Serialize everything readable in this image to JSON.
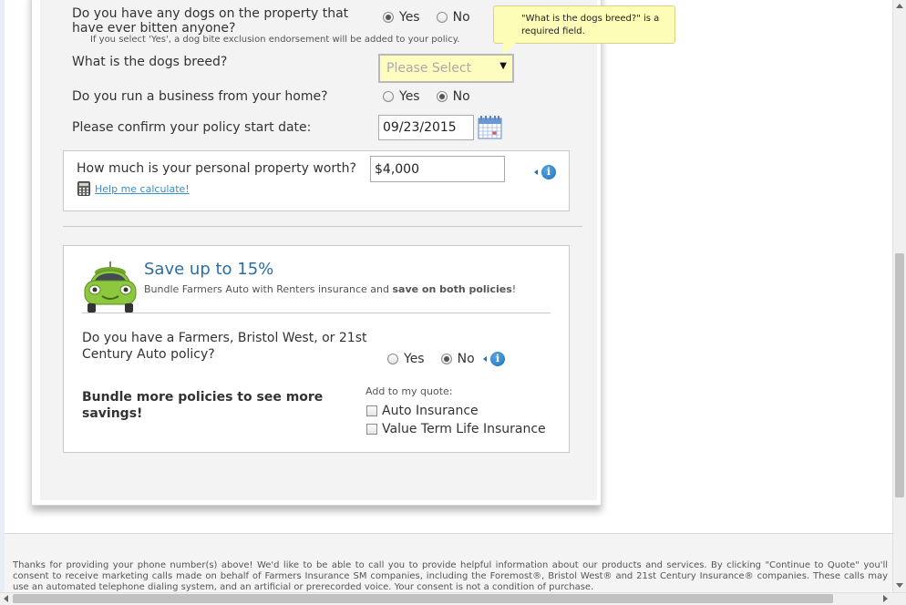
{
  "dogs_bitten": {
    "question": "Do you have any dogs on the property that have ever bitten anyone?",
    "yes_label": "Yes",
    "no_label": "No",
    "selected": "Yes",
    "note": "If you select 'Yes', a dog bite exclusion endorsement will be added to your policy."
  },
  "dog_breed": {
    "question": "What is the dogs breed?",
    "placeholder": "Please Select",
    "tooltip": "\"What is the dogs breed?\" is a required field."
  },
  "business_home": {
    "question": "Do you run a business from your home?",
    "yes_label": "Yes",
    "no_label": "No",
    "selected": "No"
  },
  "start_date": {
    "question": "Please confirm your policy start date:",
    "value": "09/23/2015"
  },
  "personal_property": {
    "question": "How much is your personal property worth?",
    "value": "$4,000",
    "help_link": "Help me calculate!"
  },
  "bundle": {
    "title": "Save up to 15%",
    "desc_prefix": "Bundle Farmers Auto with Renters insurance and ",
    "desc_bold": "save on both policies",
    "desc_suffix": "!",
    "auto_question": "Do you have a Farmers, Bristol West, or 21st Century Auto policy?",
    "yes_label": "Yes",
    "no_label": "No",
    "selected": "No",
    "more_savings": "Bundle more policies to see more savings!",
    "add_label": "Add to my quote:",
    "options": [
      {
        "label": "Auto Insurance",
        "checked": false
      },
      {
        "label": "Value Term Life Insurance",
        "checked": false
      }
    ]
  },
  "footer": {
    "text": "Thanks for providing your phone number(s) above! We'd like to be able to call you to provide helpful information about our products and services. By clicking \"Continue to Quote\" you'll consent to receive marketing calls made on behalf of Farmers Insurance SM companies, including the Foremost®, Bristol West® and 21st Century Insurance® companies. These calls may use an automated telephone dialing system, and an artificial or prerecorded voice. Your consent is not a condition of purchase."
  },
  "colors": {
    "accent": "#2e6da4",
    "link": "#3a8fc8",
    "tooltip_bg": "#fdfdb8",
    "required_field_bg": "#fdfdc0",
    "car_green": "#8dc63f"
  },
  "icons": [
    "calendar-icon",
    "info-icon",
    "calculator-icon",
    "car-icon",
    "chevron-down-icon"
  ]
}
